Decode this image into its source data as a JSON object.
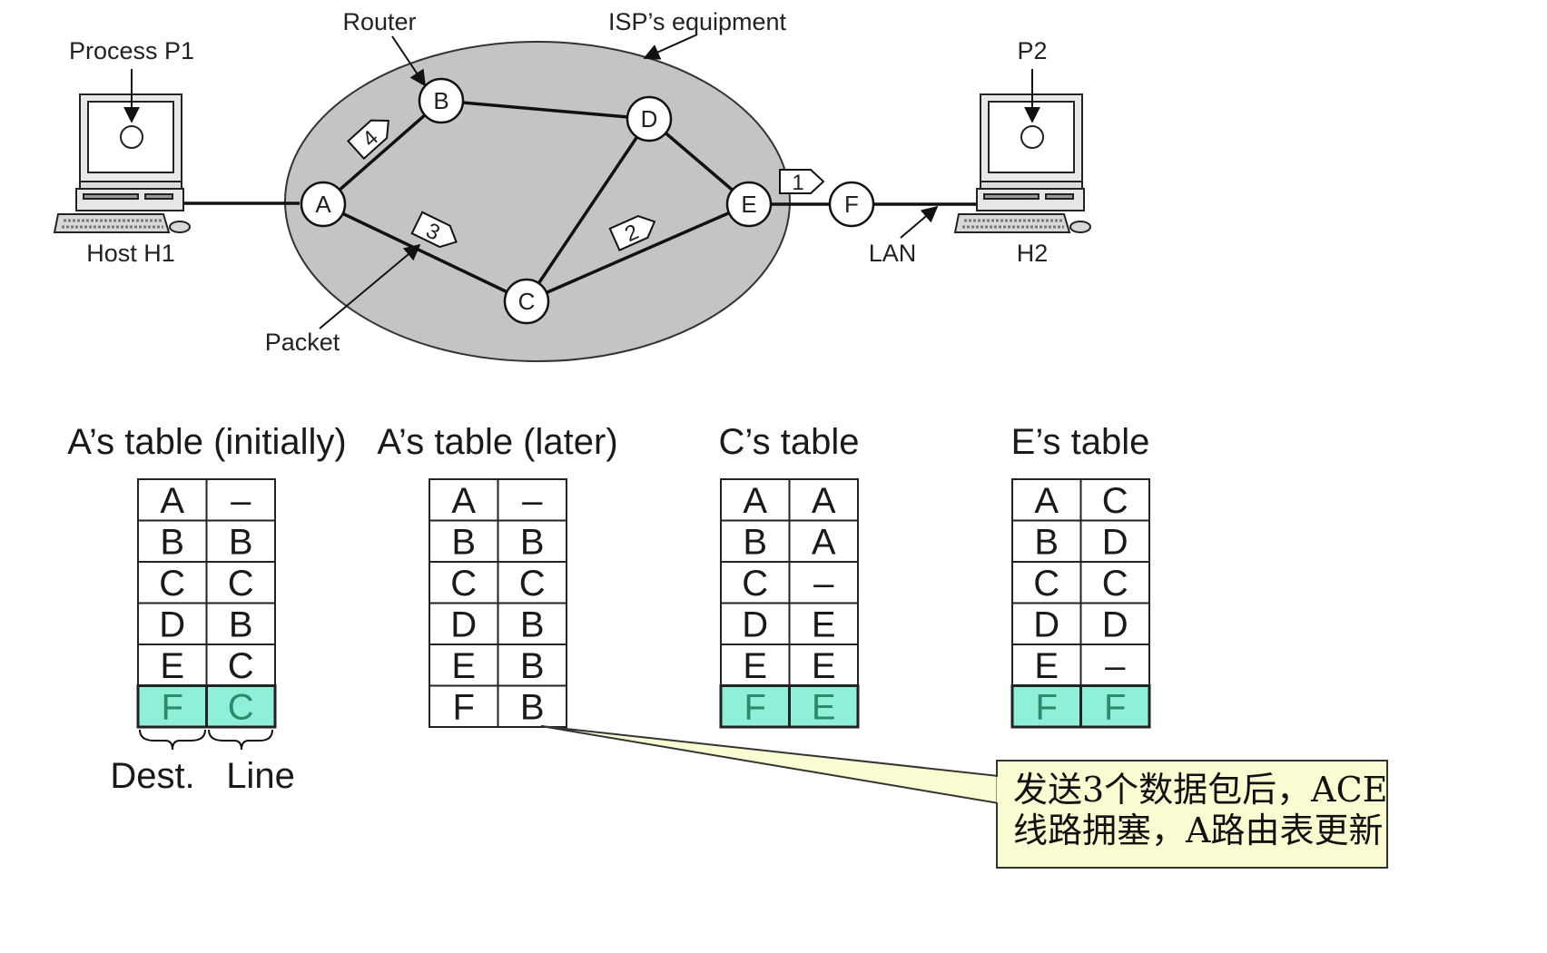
{
  "diagram": {
    "labels": {
      "router": "Router",
      "isp": "ISP’s equipment",
      "process_p1": "Process P1",
      "p2": "P2",
      "host_h1": "Host H1",
      "h2": "H2",
      "lan": "LAN",
      "packet": "Packet"
    },
    "nodes": {
      "A": "A",
      "B": "B",
      "C": "C",
      "D": "D",
      "E": "E",
      "F": "F"
    },
    "packets": {
      "p1": "1",
      "p2": "2",
      "p3": "3",
      "p4": "4"
    }
  },
  "tables": [
    {
      "title": "A’s table (initially)",
      "rows": [
        [
          "A",
          "–"
        ],
        [
          "B",
          "B"
        ],
        [
          "C",
          "C"
        ],
        [
          "D",
          "B"
        ],
        [
          "E",
          "C"
        ],
        [
          "F",
          "C"
        ]
      ],
      "highlight_last": true
    },
    {
      "title": "A’s table (later)",
      "rows": [
        [
          "A",
          "–"
        ],
        [
          "B",
          "B"
        ],
        [
          "C",
          "C"
        ],
        [
          "D",
          "B"
        ],
        [
          "E",
          "B"
        ],
        [
          "F",
          "B"
        ]
      ],
      "highlight_last": false
    },
    {
      "title": "C’s table",
      "rows": [
        [
          "A",
          "A"
        ],
        [
          "B",
          "A"
        ],
        [
          "C",
          "–"
        ],
        [
          "D",
          "E"
        ],
        [
          "E",
          "E"
        ],
        [
          "F",
          "E"
        ]
      ],
      "highlight_last": true
    },
    {
      "title": "E’s table",
      "rows": [
        [
          "A",
          "C"
        ],
        [
          "B",
          "D"
        ],
        [
          "C",
          "C"
        ],
        [
          "D",
          "D"
        ],
        [
          "E",
          "–"
        ],
        [
          "F",
          "F"
        ]
      ],
      "highlight_last": true
    }
  ],
  "columns": {
    "dest": "Dest.",
    "line": "Line"
  },
  "callout": {
    "line1": "发送3个数据包后，ACE",
    "line2": "线路拥塞，A路由表更新"
  },
  "colors": {
    "cloud": "#c4c4c4",
    "highlight": "#8ff0d8",
    "highlight_text": "#2a8a6a",
    "callout_bg": "#fbfbd2"
  }
}
